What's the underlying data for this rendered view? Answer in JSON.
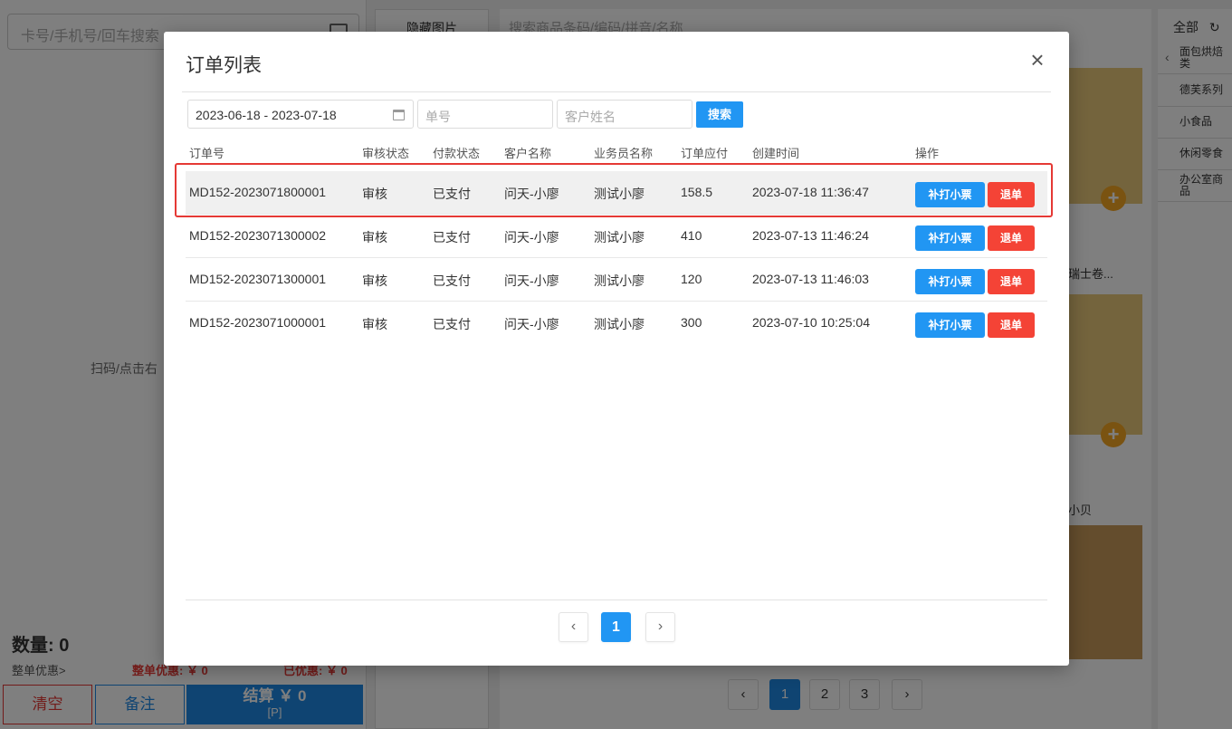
{
  "background": {
    "left": {
      "search_placeholder": "卡号/手机号/回车搜索",
      "hint": "扫码/点击右",
      "quantity": "数量: 0",
      "whole_discount_link": "整单优惠>",
      "whole_discount": "整单优惠: ￥ 0",
      "already_discount": "已优惠: ￥ 0",
      "clear_label": "清空",
      "note_label": "备注",
      "pay_label": "结算 ￥ 0",
      "pay_shortcut": "[P]"
    },
    "middle": {
      "hide_images_label": "隐藏图片"
    },
    "products": {
      "search_placeholder": "搜索商品条码/编码/拼音/名称",
      "labels": [
        "瑞士卷...",
        "小贝"
      ],
      "pages": [
        "1",
        "2",
        "3"
      ]
    },
    "categories": {
      "header": "全部",
      "items": [
        "面包烘焙类",
        "德芙系列",
        "小食品",
        "休闲零食",
        "办公室商品"
      ]
    }
  },
  "modal": {
    "title": "订单列表",
    "filters": {
      "date_range": "2023-06-18 - 2023-07-18",
      "order_no_placeholder": "单号",
      "customer_placeholder": "客户姓名",
      "search_label": "搜索"
    },
    "columns": [
      "订单号",
      "审核状态",
      "付款状态",
      "客户名称",
      "业务员名称",
      "订单应付",
      "创建时间",
      "操作"
    ],
    "rows": [
      {
        "order_no": "MD152-2023071800001",
        "audit": "审核",
        "payment": "已支付",
        "customer": "问天-小廖",
        "salesperson": "测试小廖",
        "amount": "158.5",
        "created": "2023-07-18 11:36:47"
      },
      {
        "order_no": "MD152-2023071300002",
        "audit": "审核",
        "payment": "已支付",
        "customer": "问天-小廖",
        "salesperson": "测试小廖",
        "amount": "410",
        "created": "2023-07-13 11:46:24"
      },
      {
        "order_no": "MD152-2023071300001",
        "audit": "审核",
        "payment": "已支付",
        "customer": "问天-小廖",
        "salesperson": "测试小廖",
        "amount": "120",
        "created": "2023-07-13 11:46:03"
      },
      {
        "order_no": "MD152-2023071000001",
        "audit": "审核",
        "payment": "已支付",
        "customer": "问天-小廖",
        "salesperson": "测试小廖",
        "amount": "300",
        "created": "2023-07-10 10:25:04"
      }
    ],
    "actions": {
      "reprint_label": "补打小票",
      "refund_label": "退单"
    },
    "pager": {
      "current": "1"
    }
  },
  "colors": {
    "primary": "#2196f3",
    "danger": "#f44336",
    "highlight_outline": "#e53935"
  }
}
